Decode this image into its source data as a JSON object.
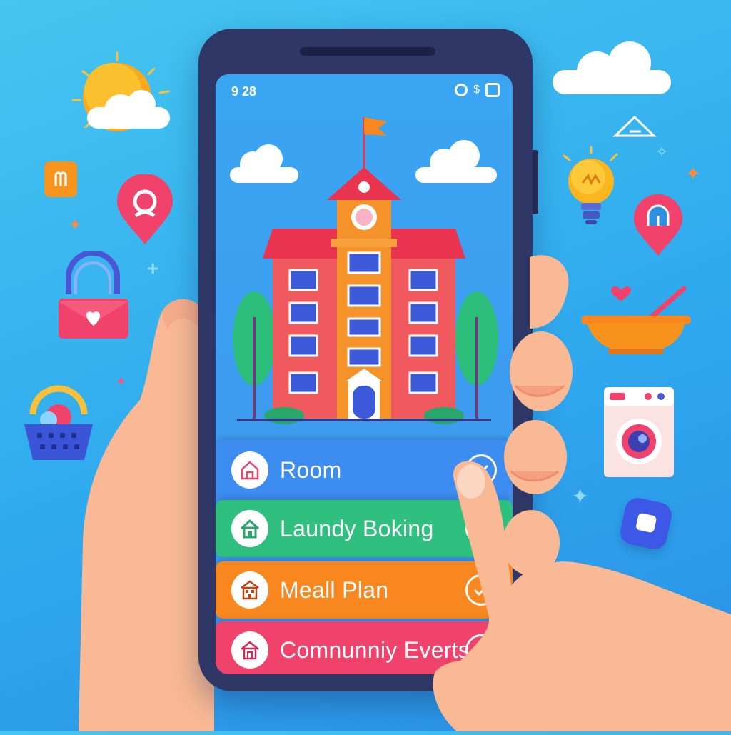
{
  "status_bar": {
    "time": "9 28",
    "signal_label": "$"
  },
  "menu": {
    "items": [
      {
        "label": "Room",
        "color": "#3d8cf0",
        "icon": "home-outline-icon",
        "checked": true
      },
      {
        "label": "Laundy Boking",
        "color": "#2fc07f",
        "icon": "house-icon",
        "checked": true
      },
      {
        "label": "Meall Plan",
        "color": "#f7871e",
        "icon": "building-icon",
        "checked": true
      },
      {
        "label": "Comnunniy Everts",
        "color": "#f0426b",
        "icon": "house-outline-icon",
        "checked": true
      }
    ]
  },
  "colors": {
    "background": "#2fa9ee",
    "phone_frame": "#2f3767",
    "building_main": "#f05a5e",
    "tower": "#f5932a",
    "roof": "#e8344f"
  }
}
